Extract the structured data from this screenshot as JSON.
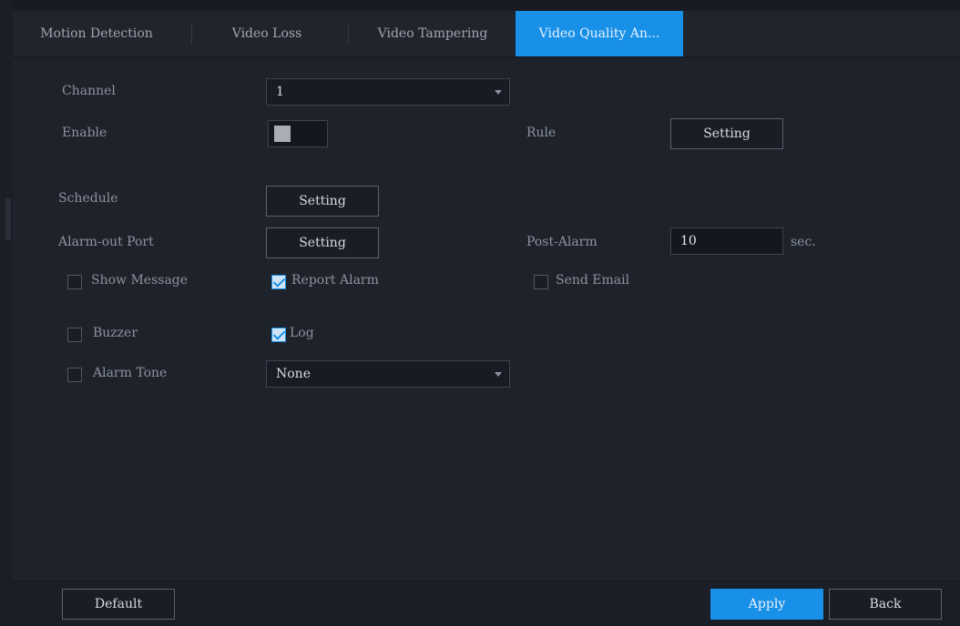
{
  "tabs": [
    {
      "label": "Motion Detection",
      "active": false
    },
    {
      "label": "Video Loss",
      "active": false
    },
    {
      "label": "Video Tampering",
      "active": false
    },
    {
      "label": "Video Quality An...",
      "active": true
    }
  ],
  "form": {
    "channel_label": "Channel",
    "channel_value": "1",
    "enable_label": "Enable",
    "enable_state": "off",
    "rule_label": "Rule",
    "rule_button": "Setting",
    "schedule_label": "Schedule",
    "schedule_button": "Setting",
    "alarm_out_label": "Alarm-out Port",
    "alarm_out_button": "Setting",
    "post_alarm_label": "Post-Alarm",
    "post_alarm_value": "10",
    "post_alarm_unit": "sec.",
    "show_message_label": "Show Message",
    "show_message_checked": false,
    "report_alarm_label": "Report Alarm",
    "report_alarm_checked": true,
    "send_email_label": "Send Email",
    "send_email_checked": false,
    "buzzer_label": "Buzzer",
    "buzzer_checked": false,
    "log_label": "Log",
    "log_checked": true,
    "alarm_tone_label": "Alarm Tone",
    "alarm_tone_checked": false,
    "alarm_tone_value": "None"
  },
  "footer": {
    "default_label": "Default",
    "apply_label": "Apply",
    "back_label": "Back"
  },
  "colors": {
    "accent": "#1890e8",
    "background": "#1e222b"
  }
}
